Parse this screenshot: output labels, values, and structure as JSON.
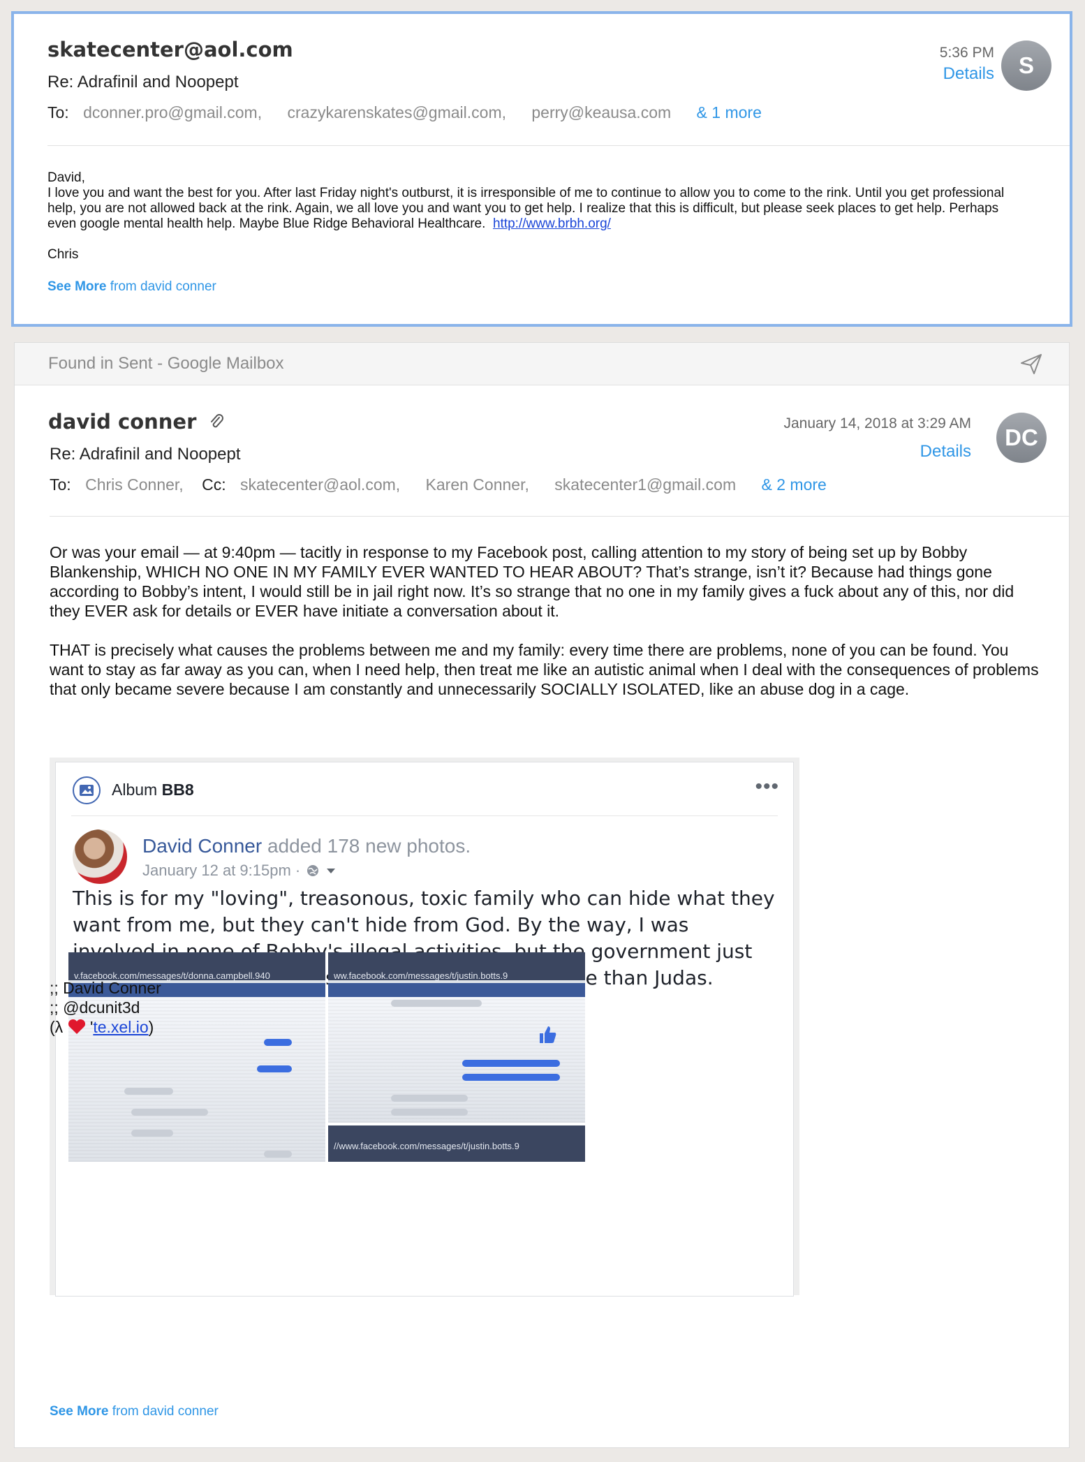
{
  "message1": {
    "from": "skatecenter@aol.com",
    "time": "5:36 PM",
    "details": "Details",
    "avatar_initial": "S",
    "subject": "Re: Adrafinil and Noopept",
    "to_label": "To:",
    "recipients": [
      "dconner.pro@gmail.com,",
      "crazykarenskates@gmail.com,",
      "perry@keausa.com"
    ],
    "more": "& 1 more",
    "body": {
      "greeting": "David,",
      "paragraph": "I love you and want the best for you.  After last Friday night's outburst, it is irresponsible of me to continue to allow you to come to the rink.  Until you get professional help, you are not allowed back at the rink.  Again, we all love you and want you to get help.  I realize that this is difficult, but please seek places to get help.  Perhaps even google mental health help.  Maybe Blue Ridge Behavioral Healthcare.",
      "link": "http://www.brbh.org/",
      "signoff": "Chris"
    },
    "see_more_bold": "See More",
    "see_more_rest": " from david conner"
  },
  "message2": {
    "found_in": "Found in Sent - Google Mailbox",
    "from": "david conner",
    "time": "January 14, 2018 at 3:29 AM",
    "details": "Details",
    "avatar_initials": "DC",
    "subject": "Re: Adrafinil and Noopept",
    "to_label": "To:",
    "to": "Chris Conner,",
    "cc_label": "Cc:",
    "cc": [
      "skatecenter@aol.com,",
      "Karen Conner,",
      "skatecenter1@gmail.com"
    ],
    "more": "& 2 more",
    "paragraph1": "Or was your email — at 9:40pm — tacitly in response to my Facebook post, calling attention to my story of being set up by Bobby Blankenship, WHICH NO ONE IN MY FAMILY EVER WANTED TO HEAR ABOUT? That’s strange, isn’t it? Because had things gone according to Bobby’s intent, I would still be in jail right now. It’s so strange that no one in my family gives a fuck about any of this, nor did they EVER ask for details or EVER have initiate a conversation about it.",
    "paragraph2": "THAT is precisely what causes the problems between me and my family: every time there are problems, none of you can be found. You want to stay as far away as you can, when I need help, then treat me like an autistic animal when I deal with the consequences of problems that only became severe because I am constantly and unnecessarily SOCIALLY ISOLATED, like an abuse dog in a cage.",
    "facebook": {
      "album_prefix": "Album ",
      "album_name": "BB8",
      "poster": "David Conner",
      "action": " added 178 new photos.",
      "date": "January 12 at 9:15pm ·",
      "post": "This is for my \"loving\", treasonous, toxic family who can hide what they want from me, but they can't hide from God. By the way, I was involved in none of Bobby's illegal activities, but the government just had to target me. As far as I'm concerned, he's worse than Judas.",
      "photo_urls": [
        "v.facebook.com/messages/t/donna.campbell.940",
        "ww.facebook.com/messages/t/justin.botts.9",
        "//www.facebook.com/messages/t/justin.botts.9"
      ]
    },
    "signature": {
      "line1": ";; David Conner",
      "line2": ";; @dcunit3d",
      "line3_prefix": "(λ ",
      "line3_mid": "  '",
      "link": "te.xel.io",
      "line3_suffix": ")"
    },
    "see_more_bold": "See More",
    "see_more_rest": " from david conner"
  }
}
